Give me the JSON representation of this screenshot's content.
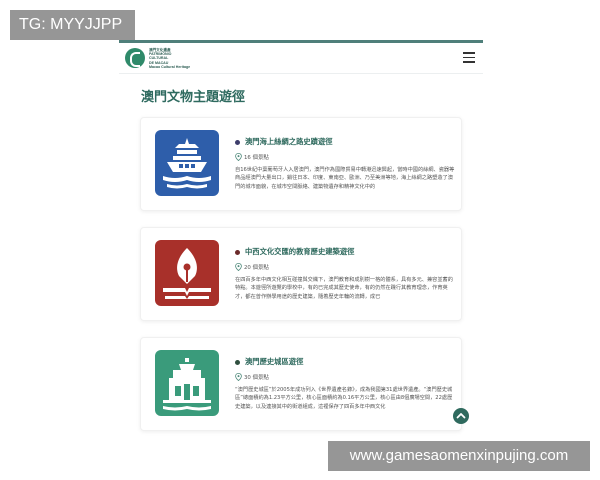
{
  "watermarks": {
    "top": "TG: MYYJJPP",
    "bottom": "www.gamesaomenxinpujing.com"
  },
  "header": {
    "logo_lines": [
      "澳門文化遺產",
      "PATRIMÓNIO",
      "CULTURAL",
      "DE MACAU",
      "Macao Cultural Heritage"
    ],
    "menu_icon": "hamburger-menu-icon"
  },
  "page": {
    "title": "澳門文物主題遊徑"
  },
  "routes": [
    {
      "title": "澳門海上絲綢之路史蹟遊徑",
      "count": "16 個景點",
      "description": "自16世紀中葉葡萄牙人入居澳門，澳門作為國際貿易中轉港迅速興起，當時中國的絲綢、瓷器等商品經澳門大量出口，銷往日本、印度、東南亞、歐洲、乃至美洲等地，海上絲綢之路塑造了澳門的城市面貌，在城市空間脈絡、建築物遺存和精神文化中的",
      "icon": "ship-icon",
      "color": "#2e5eaa",
      "dot_color": "#3d3d6b"
    },
    {
      "title": "中西文化交匯的教育歷史建築遊徑",
      "count": "20 個景點",
      "description": "在四百多年中西文化相互碰撞與交織下，澳門教育和成別樹一格的體系，具有多元、兼容並蓄的特點。本遊徑所遊覽的學校中，有的已完成其歷史使命，有的仍然在踐行其教育理念，作育英才，都在曾作辦學用途的歷史建築，隨着歷史年輪的流轉，成已",
      "icon": "pen-nib-icon",
      "color": "#a8302a",
      "dot_color": "#6b2a2a"
    },
    {
      "title": "澳門歷史城區遊徑",
      "count": "30 個景點",
      "description": "“澳門歷史城區”於2005年成功列入《世界遺產名錄》，成為我國第31處世界遺產。“澳門歷史城區”總面積約為1.23平方公里，核心區面積約為0.16平方公里，核心區由8個廣場空間，22處歷史建築，以及連接其中的街道組成，這裡保存了四百多年中西文化",
      "icon": "ruins-facade-icon",
      "color": "#3a9b7b",
      "dot_color": "#2f4f3f"
    }
  ],
  "scroll_top_icon": "chevron-up-icon"
}
